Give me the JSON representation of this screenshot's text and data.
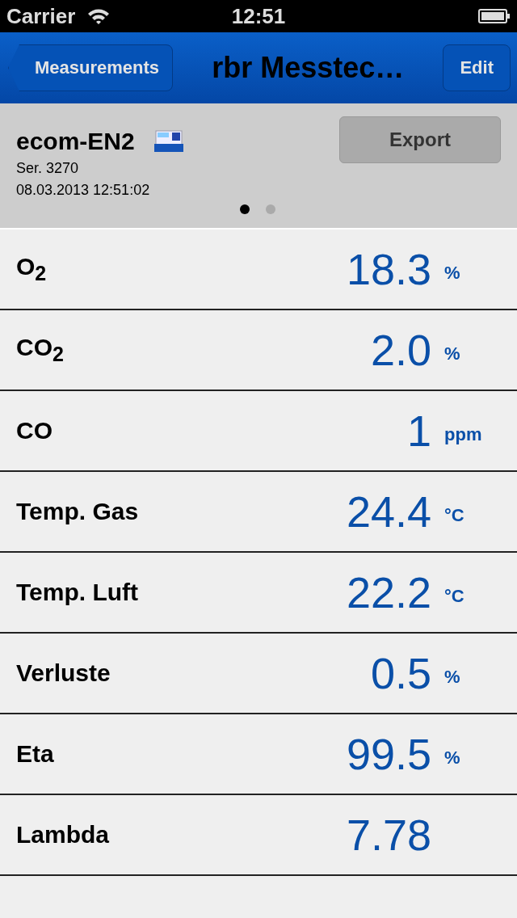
{
  "status_bar": {
    "carrier": "Carrier",
    "time": "12:51"
  },
  "nav_bar": {
    "back": "Measurements",
    "title": "rbr Messtec…",
    "edit": "Edit"
  },
  "device": {
    "name": "ecom-EN2",
    "serial": "Ser. 3270",
    "timestamp": "08.03.2013 12:51:02",
    "export": "Export",
    "pages": [
      {
        "selected": true
      },
      {
        "selected": false
      }
    ]
  },
  "measurements": [
    {
      "label": "O$_{2}$",
      "value": "18.3",
      "unit": "%"
    },
    {
      "label": "CO$_{2}$",
      "value": "2.0",
      "unit": "%"
    },
    {
      "label": "CO",
      "value": "1",
      "unit": "ppm"
    },
    {
      "label": "Temp. Gas",
      "value": "24.4",
      "unit": "°C"
    },
    {
      "label": "Temp. Luft",
      "value": "22.2",
      "unit": "°C"
    },
    {
      "label": "Verluste",
      "value": "0.5",
      "unit": "%"
    },
    {
      "label": "Eta",
      "value": "99.5",
      "unit": "%"
    },
    {
      "label": "Lambda",
      "value": "7.78"
    }
  ]
}
